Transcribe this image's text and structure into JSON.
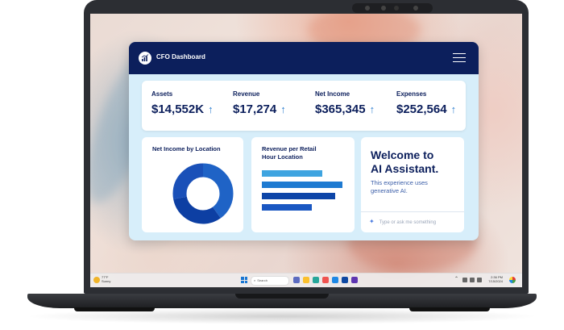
{
  "app": {
    "title": "CFO Dashboard"
  },
  "kpis": [
    {
      "label": "Assets",
      "value": "$14,552K",
      "trend": "↑"
    },
    {
      "label": "Revenue",
      "value": "$17,274",
      "trend": "↑"
    },
    {
      "label": "Net Income",
      "value": "$365,345",
      "trend": "↑"
    },
    {
      "label": "Expenses",
      "value": "$252,564",
      "trend": "↑"
    }
  ],
  "panels": {
    "net_income": {
      "title": "Net Income by Location"
    },
    "revenue_retail": {
      "title_line1": "Revenue per Retail",
      "title_line2": "Hour Location"
    },
    "ai": {
      "title_line1": "Welcome to",
      "title_line2": "AI Assistant.",
      "subtitle_line1": "This experience uses",
      "subtitle_line2": "generative AI.",
      "input_placeholder": "Type or ask me something"
    }
  },
  "taskbar": {
    "weather_temp": "77°F",
    "weather_desc": "Sunny",
    "search_placeholder": "Search",
    "time": "2:36 PM",
    "date": "7/15/2024"
  },
  "colors": {
    "header_navy": "#0c1f5c",
    "panel_bg": "#d7eefa",
    "accent_blue": "#2f7fd0"
  },
  "donut": {
    "segments": [
      {
        "fraction": 0.4,
        "color": "#1f63c6"
      },
      {
        "fraction": 0.32,
        "color": "#0d3fa3"
      },
      {
        "fraction": 0.28,
        "color": "#1a50b8"
      }
    ]
  },
  "bars": {
    "values": [
      75,
      100,
      91,
      62
    ],
    "colors": [
      "#3ea4e0",
      "#1e7ad1",
      "#0d45a8",
      "#1a57c2"
    ]
  }
}
